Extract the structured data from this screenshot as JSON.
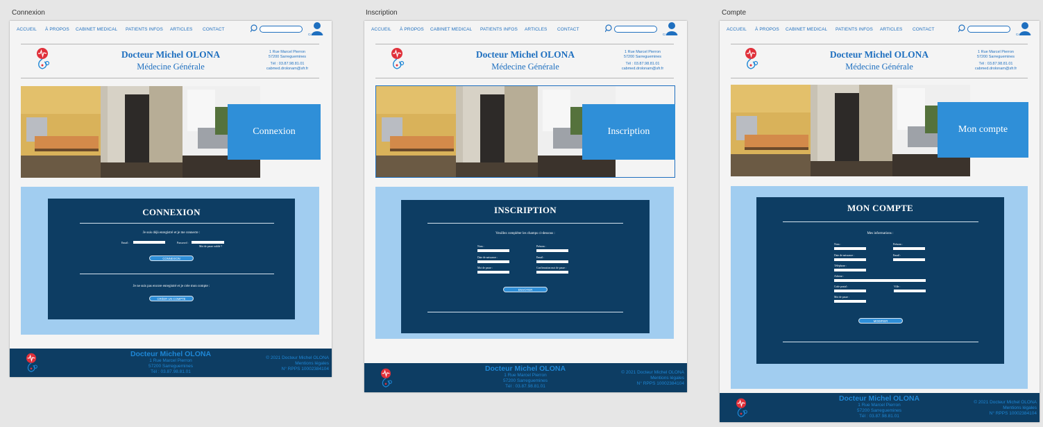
{
  "nav": {
    "items": [
      "ACCUEIL",
      "À PROPOS",
      "CABINET MEDICAL",
      "PATIENTS INFOS",
      "ARTICLES",
      "CONTACT"
    ],
    "user_label": "Connexion"
  },
  "header": {
    "doctor_name": "Docteur Michel OLONA",
    "specialty": "Médecine Générale",
    "address_line1": "1 Rue Marcel Pierron",
    "address_line2": "57200 Sarreguemines",
    "phone": "Tél : 03.87.98.81.01",
    "email": "cabmed.drolonam@sfr.fr"
  },
  "footer": {
    "name": "Docteur Michel OLONA",
    "line1": "1 Rue Marcel Pierron",
    "line2": "57200 Sarreguemines",
    "line3": "Tél : 03.87.98.81.01",
    "right1": "© 2021 Docteur Michel OLONA",
    "right2": "Mentions légales",
    "right3": "N° RPPS 10002384104"
  },
  "artboards": {
    "login": {
      "title": "Connexion",
      "banner": "Connexion",
      "panel_title": "CONNEXION",
      "intro": "Je suis déjà enregistré et je me connecte :",
      "email_label": "Email :",
      "password_label": "Password :",
      "forgot": "Mot de passe oublié ?",
      "login_button": "CONNEXION",
      "register_intro": "Je ne suis pas encore enregistré et je crée mon compte :",
      "register_button": "CRÉER UN COMPTE"
    },
    "signup": {
      "title": "Inscription",
      "banner": "Inscription",
      "panel_title": "INSCRIPTION",
      "intro": "Veuillez compléter les champs ci-dessous :",
      "name_label": "Nom :",
      "firstname_label": "Prénom :",
      "birth_label": "Date de naissance :",
      "email_label": "Email :",
      "password_label": "Mot de passe :",
      "confirm_label": "Confirmation mot de passe :",
      "send_button": "ENVOYER"
    },
    "account": {
      "title": "Compte",
      "banner": "Mon compte",
      "panel_title": "MON COMPTE",
      "intro": "Mes informations :",
      "name_label": "Nom :",
      "firstname_label": "Prénom :",
      "birth_label": "Date de naissance :",
      "email_label": "Email :",
      "phone_label": "Téléphone :",
      "address_label": "Adresse :",
      "postal_label": "Code postal :",
      "city_label": "Ville :",
      "password_label": "Mot de passe :",
      "modify_button": "MODIFIER"
    }
  },
  "colors": {
    "accent": "#1e6fbf",
    "banner": "#2f8fd8",
    "dark_panel": "#0d3d63",
    "light_block": "#a1cdf0",
    "logo_red": "#e0303a"
  }
}
